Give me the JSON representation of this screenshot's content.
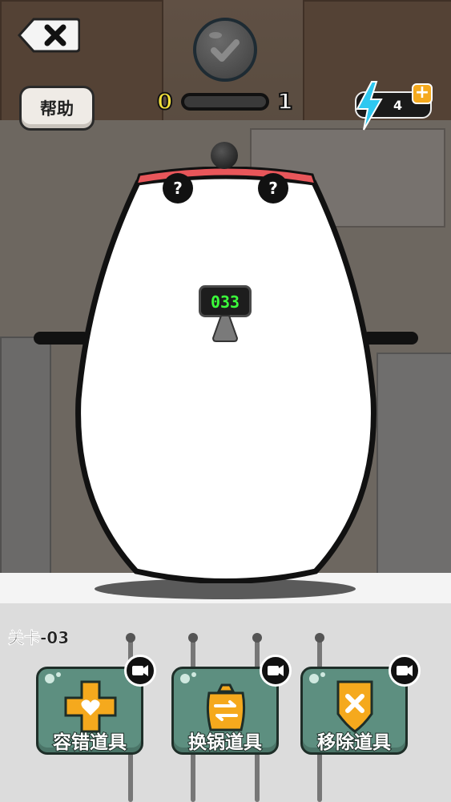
{
  "header": {
    "back_icon": "close-x-icon",
    "help_label": "帮助",
    "complete_icon": "check-icon"
  },
  "progress": {
    "current": "0",
    "target": "1",
    "fraction": 0.0
  },
  "energy": {
    "icon": "lightning-bolt-icon",
    "count": "4",
    "add_icon": "plus-icon"
  },
  "pot": {
    "lid_color": "#e8565a",
    "mystery_marks": [
      "?",
      "?"
    ],
    "timer": "033",
    "timer_color": "#3bff3b"
  },
  "level": {
    "label": "关卡-03"
  },
  "tools": [
    {
      "label": "容错道具",
      "icon": "heart-cross-icon",
      "badge_icon": "video-icon"
    },
    {
      "label": "换锅道具",
      "icon": "swap-pot-icon",
      "badge_icon": "video-icon"
    },
    {
      "label": "移除道具",
      "icon": "remove-x-icon",
      "badge_icon": "video-icon"
    }
  ],
  "colors": {
    "tool_bg": "#5d8f80",
    "accent": "#f5a91d"
  }
}
